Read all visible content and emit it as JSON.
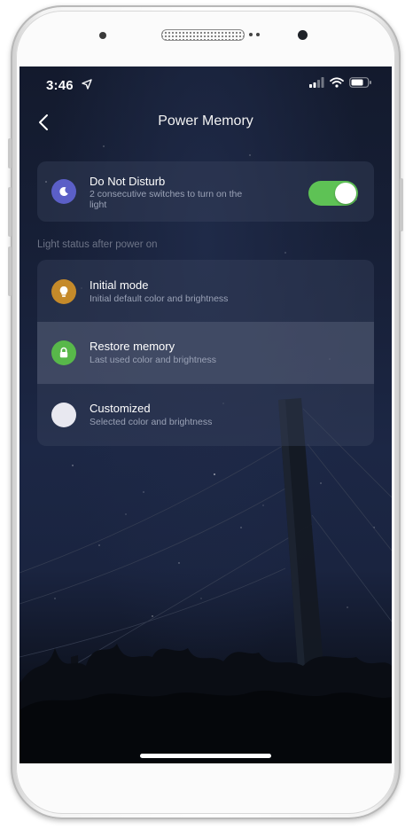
{
  "status_bar": {
    "time": "3:46",
    "icons": [
      "location-arrow-icon",
      "signal-icon",
      "wifi-icon",
      "battery-icon"
    ]
  },
  "nav": {
    "back_icon": "chevron-left-icon",
    "title": "Power Memory"
  },
  "do_not_disturb": {
    "icon": "moon-icon",
    "title": "Do Not Disturb",
    "subtitle_line1": "2 consecutive switches to turn on the",
    "subtitle_line2": "light",
    "enabled": true
  },
  "section_label": "Light status after power on",
  "options": [
    {
      "icon": "lightbulb-icon",
      "title": "Initial mode",
      "subtitle": "Initial default color and brightness",
      "selected": false
    },
    {
      "icon": "lock-icon",
      "title": "Restore memory",
      "subtitle": "Last used color and brightness",
      "selected": true
    },
    {
      "icon": "circle-icon",
      "title": "Customized",
      "subtitle": "Selected color and brightness",
      "selected": false
    }
  ],
  "colors": {
    "toggle_on": "#5ec255",
    "moon_icon_bg": "#5b5fc7",
    "bulb_icon_bg": "#c58a2a",
    "lock_icon_bg": "#58b84a",
    "custom_icon_bg": "#e8e8f0"
  }
}
